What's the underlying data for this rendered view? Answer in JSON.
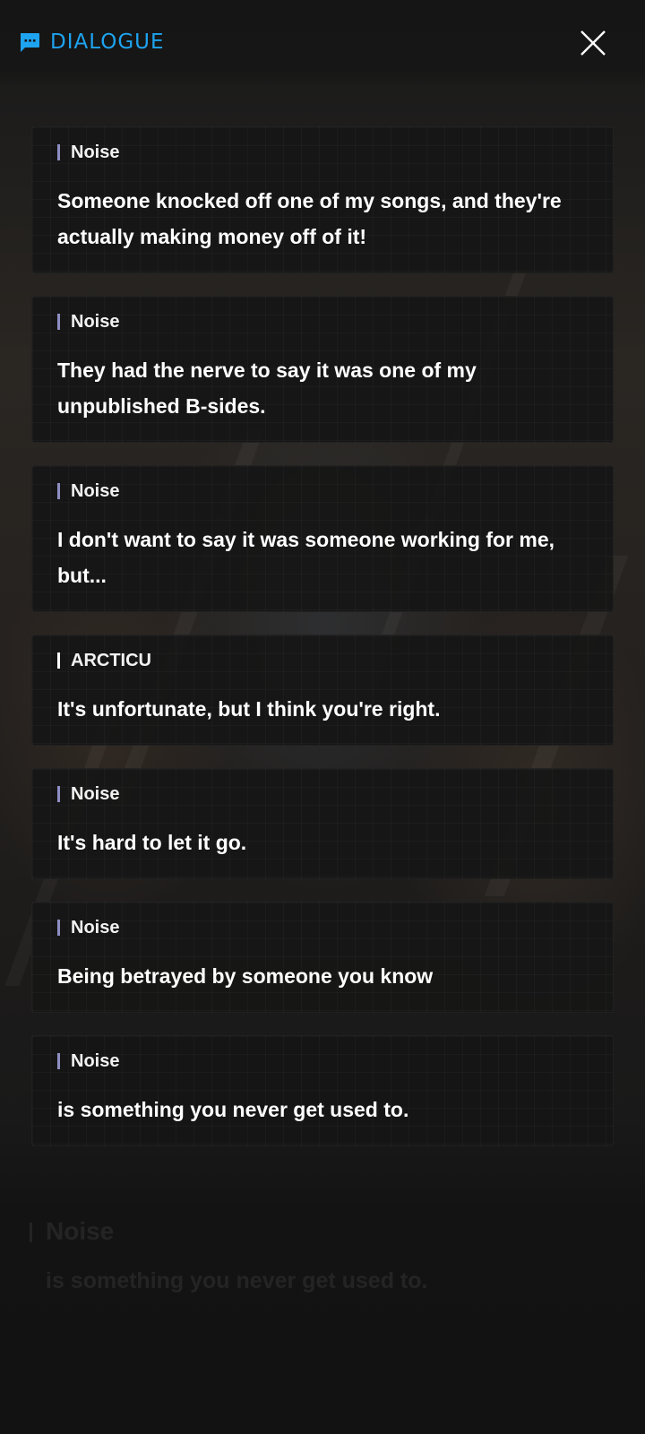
{
  "header": {
    "title": "DIALOGUE",
    "icon": "chat-bubble-icon",
    "close_icon": "close-icon",
    "accent_color": "#1ea3f0"
  },
  "dialogue": [
    {
      "speaker": "Noise",
      "text": "Someone knocked off one of my songs, and they're actually making money off of it!"
    },
    {
      "speaker": "Noise",
      "text": "They had the nerve to say it was one of my unpublished B-sides."
    },
    {
      "speaker": "Noise",
      "text": "I don't want to say it was someone working for me, but..."
    },
    {
      "speaker": "ARCTICU",
      "text": "It's unfortunate, but I think you're right."
    },
    {
      "speaker": "Noise",
      "text": "It's hard to let it go."
    },
    {
      "speaker": "Noise",
      "text": "Being betrayed by someone you know"
    },
    {
      "speaker": "Noise",
      "text": "is something you never get used to."
    }
  ],
  "background_line": {
    "speaker": "Noise",
    "text": "is something you never get used to."
  }
}
